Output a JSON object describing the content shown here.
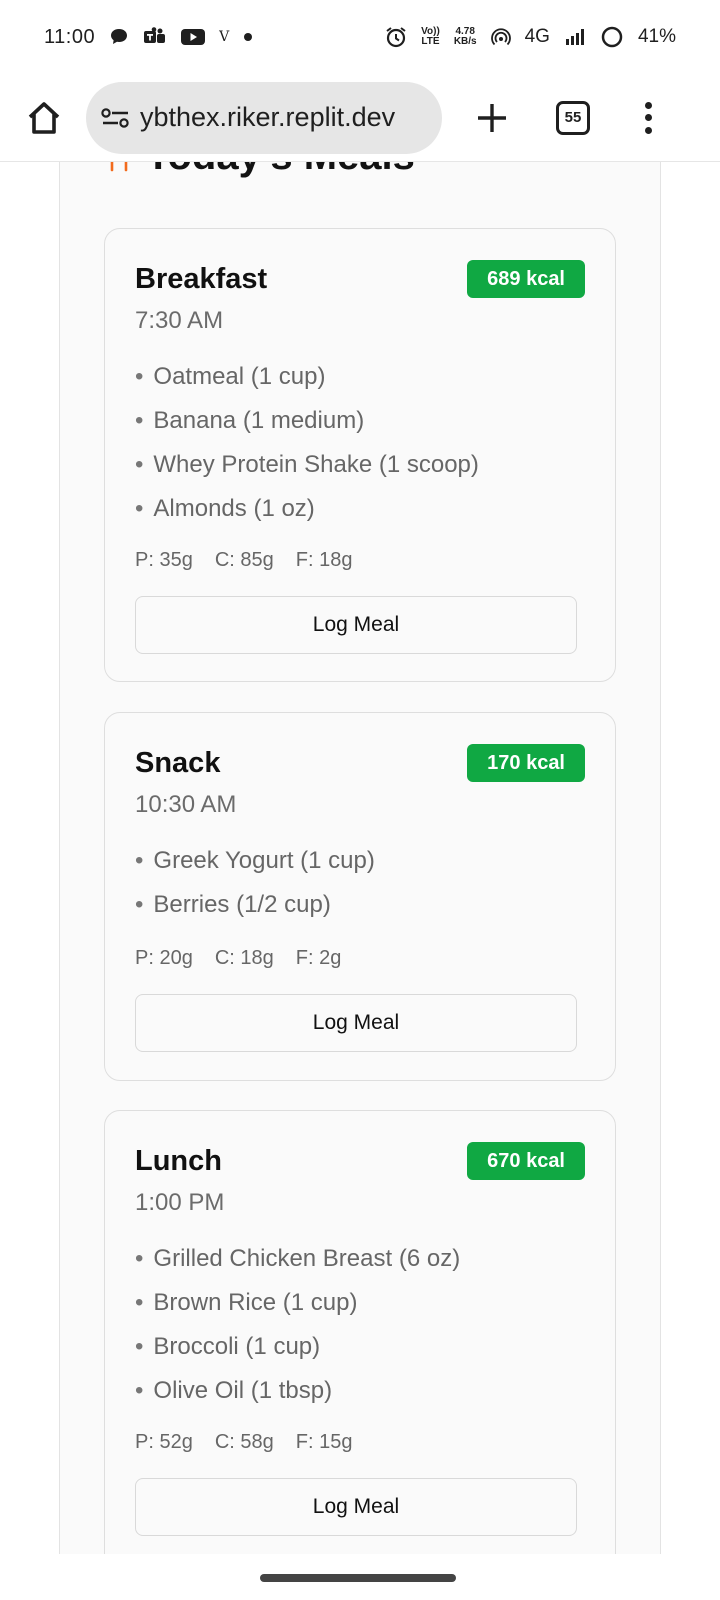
{
  "status_bar": {
    "time": "11:00",
    "v_label": "V",
    "volte_top": "Vo))",
    "volte_bottom": "LTE",
    "speed_top": "4.78",
    "speed_bottom": "KB/s",
    "network": "4G",
    "battery": "41%",
    "icons": [
      "chat-icon",
      "teams-icon",
      "youtube-icon",
      "dot-icon",
      "alarm-icon",
      "hotspot-icon",
      "signal-icon",
      "battery-icon"
    ]
  },
  "browser": {
    "url": "ybthex.riker.replit.dev",
    "tab_count": "55",
    "icons": [
      "home-icon",
      "site-settings-icon",
      "plus-icon",
      "tabs-icon",
      "more-icon"
    ]
  },
  "page": {
    "section_title": "Today's Meals",
    "accent_color": "#f26b1d",
    "badge_color": "#10a843",
    "meals": [
      {
        "name": "Breakfast",
        "time": "7:30 AM",
        "kcal": "689 kcal",
        "foods": [
          "Oatmeal (1 cup)",
          "Banana (1 medium)",
          "Whey Protein Shake (1 scoop)",
          "Almonds (1 oz)"
        ],
        "protein": "P: 35g",
        "carbs": "C: 85g",
        "fat": "F: 18g",
        "button": "Log Meal"
      },
      {
        "name": "Snack",
        "time": "10:30 AM",
        "kcal": "170 kcal",
        "foods": [
          "Greek Yogurt (1 cup)",
          "Berries (1/2 cup)"
        ],
        "protein": "P: 20g",
        "carbs": "C: 18g",
        "fat": "F: 2g",
        "button": "Log Meal"
      },
      {
        "name": "Lunch",
        "time": "1:00 PM",
        "kcal": "670 kcal",
        "foods": [
          "Grilled Chicken Breast (6 oz)",
          "Brown Rice (1 cup)",
          "Broccoli (1 cup)",
          "Olive Oil (1 tbsp)"
        ],
        "protein": "P: 52g",
        "carbs": "C: 58g",
        "fat": "F: 15g",
        "button": "Log Meal"
      }
    ]
  }
}
